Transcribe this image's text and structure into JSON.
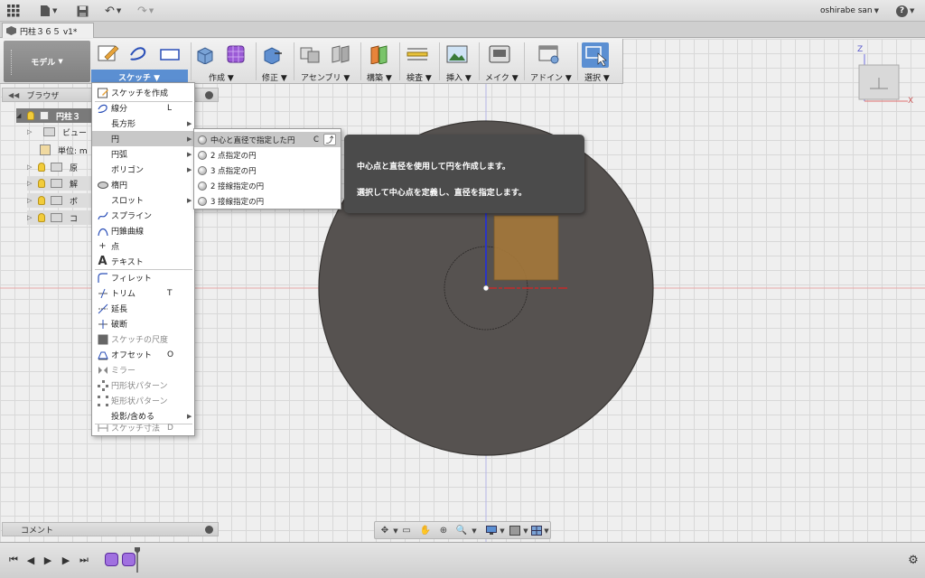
{
  "appbar": {
    "user": "oshirabe san",
    "help": "?"
  },
  "document": {
    "tab_title": "円柱３６５ v1*"
  },
  "toolbar": {
    "workspace": "モデル",
    "groups": {
      "sketch": "スケッチ",
      "create": "作成",
      "modify": "修正",
      "assemble": "アセンブリ",
      "construct": "構築",
      "inspect": "検査",
      "insert": "挿入",
      "make": "メイク",
      "addins": "アドイン",
      "select": "選択"
    }
  },
  "browser": {
    "title": "ブラウザ",
    "root": "円柱３",
    "items": [
      {
        "label": "ビュー"
      },
      {
        "label": "単位: m"
      },
      {
        "label": "原"
      },
      {
        "label": "解"
      },
      {
        "label": "ボ"
      },
      {
        "label": "コ"
      }
    ]
  },
  "sketch_menu": {
    "items": [
      {
        "label": "スケッチを作成",
        "shortcut": ""
      },
      {
        "label": "線分",
        "shortcut": "L"
      },
      {
        "label": "長方形",
        "shortcut": ""
      },
      {
        "label": "円",
        "shortcut": ""
      },
      {
        "label": "円弧",
        "shortcut": ""
      },
      {
        "label": "ポリゴン",
        "shortcut": ""
      },
      {
        "label": "楕円",
        "shortcut": ""
      },
      {
        "label": "スロット",
        "shortcut": ""
      },
      {
        "label": "スプライン",
        "shortcut": ""
      },
      {
        "label": "円錐曲線",
        "shortcut": ""
      },
      {
        "label": "点",
        "shortcut": ""
      },
      {
        "label": "テキスト",
        "shortcut": ""
      },
      {
        "label": "フィレット",
        "shortcut": ""
      },
      {
        "label": "トリム",
        "shortcut": "T"
      },
      {
        "label": "延長",
        "shortcut": ""
      },
      {
        "label": "破断",
        "shortcut": ""
      },
      {
        "label": "スケッチの尺度",
        "shortcut": ""
      },
      {
        "label": "オフセット",
        "shortcut": "O"
      },
      {
        "label": "ミラー",
        "shortcut": ""
      },
      {
        "label": "円形状パターン",
        "shortcut": ""
      },
      {
        "label": "矩形状パターン",
        "shortcut": ""
      },
      {
        "label": "投影/含める",
        "shortcut": ""
      },
      {
        "label": "スケッチ寸法",
        "shortcut": "D"
      }
    ]
  },
  "circle_submenu": {
    "items": [
      {
        "label": "中心と直径で指定した円",
        "shortcut": "C"
      },
      {
        "label": "2 点指定の円"
      },
      {
        "label": "3 点指定の円"
      },
      {
        "label": "2 接線指定の円"
      },
      {
        "label": "3 接線指定の円"
      }
    ]
  },
  "tooltip": {
    "line1": "中心点と直径を使用して円を作成します。",
    "line2": "選択して中心点を定義し、直径を指定します。"
  },
  "comments": {
    "label": "コメント"
  },
  "viewcube": {
    "z_label": "Z",
    "x_label": "X"
  },
  "colors": {
    "accent": "#5b8fd2",
    "disk": "#565250",
    "tooltip_bg": "#4b4b4b",
    "sketch_rect": "#a5783a"
  }
}
